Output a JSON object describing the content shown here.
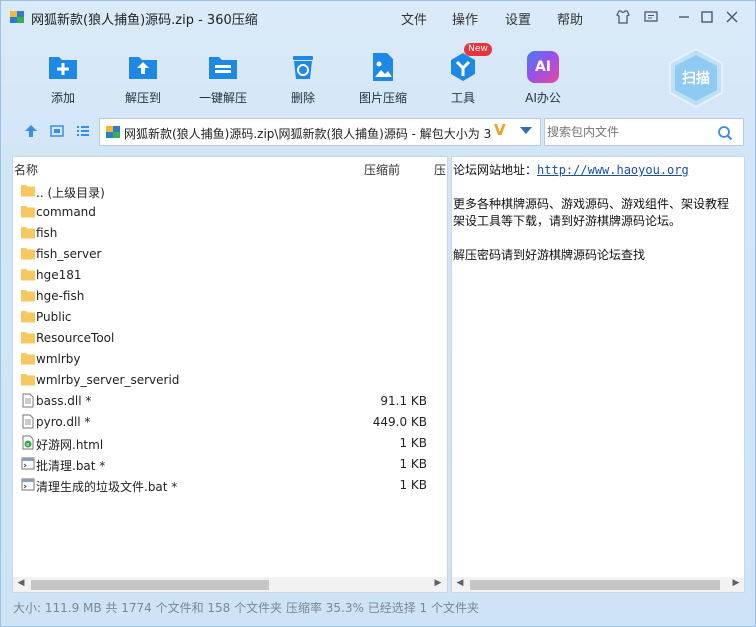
{
  "title_bar": {
    "title": "网狐新款(狼人捕鱼)源码.zip - 360压缩",
    "menus": [
      "文件",
      "操作",
      "设置",
      "帮助"
    ]
  },
  "toolbar": {
    "buttons": [
      {
        "label": "添加",
        "icon": "add-icon"
      },
      {
        "label": "解压到",
        "icon": "extract-to-icon"
      },
      {
        "label": "一键解压",
        "icon": "one-click-extract-icon"
      },
      {
        "label": "删除",
        "icon": "delete-icon"
      },
      {
        "label": "图片压缩",
        "icon": "image-compress-icon"
      },
      {
        "label": "工具",
        "icon": "tools-icon"
      },
      {
        "label": "AI办公",
        "icon": "ai-office-icon"
      }
    ],
    "new_badge": "New",
    "ai_icon_text": "AI",
    "scan_label": "扫描"
  },
  "address": {
    "path": "网狐新款(狼人捕鱼)源码.zip\\网狐新款(狼人捕鱼)源码 - 解包大小为 3",
    "vip_mark": "V",
    "search_placeholder": "搜索包内文件"
  },
  "file_list": {
    "columns": {
      "name": "名称",
      "size": "压缩前",
      "packed": "压"
    },
    "rows": [
      {
        "name": ".. (上级目录)",
        "size": "",
        "type": "folder"
      },
      {
        "name": "command",
        "size": "",
        "type": "folder"
      },
      {
        "name": "fish",
        "size": "",
        "type": "folder"
      },
      {
        "name": "fish_server",
        "size": "",
        "type": "folder"
      },
      {
        "name": "hge181",
        "size": "",
        "type": "folder"
      },
      {
        "name": "hge-fish",
        "size": "",
        "type": "folder"
      },
      {
        "name": "Public",
        "size": "",
        "type": "folder"
      },
      {
        "name": "ResourceTool",
        "size": "",
        "type": "folder"
      },
      {
        "name": "wmlrby",
        "size": "",
        "type": "folder"
      },
      {
        "name": "wmlrby_server_serverid",
        "size": "",
        "type": "folder"
      },
      {
        "name": "bass.dll *",
        "size": "91.1 KB",
        "type": "dll"
      },
      {
        "name": "pyro.dll *",
        "size": "449.0 KB",
        "type": "dll"
      },
      {
        "name": "好游网.html",
        "size": "1 KB",
        "type": "html"
      },
      {
        "name": "批清理.bat *",
        "size": "1 KB",
        "type": "bat"
      },
      {
        "name": "清理生成的垃圾文件.bat *",
        "size": "1 KB",
        "type": "bat"
      }
    ]
  },
  "comment": {
    "line1_prefix": "论坛网站地址：",
    "line1_link": "http://www.haoyou.org",
    "line2": "更多各种棋牌源码、游戏源码、游戏组件、架设教程",
    "line3": "架设工具等下载，请到好游棋牌源码论坛。",
    "line4": "解压密码请到好游棋牌源码论坛查找"
  },
  "status_bar": {
    "text": "大小: 111.9 MB 共 1774 个文件和 158 个文件夹 压缩率 35.3% 已经选择 1 个文件夹"
  },
  "colors": {
    "accent_blue": "#1e88e5",
    "folder_yellow": "#f6c85f",
    "window_bg": "#d3e6f8",
    "badge_red": "#e8343a"
  }
}
